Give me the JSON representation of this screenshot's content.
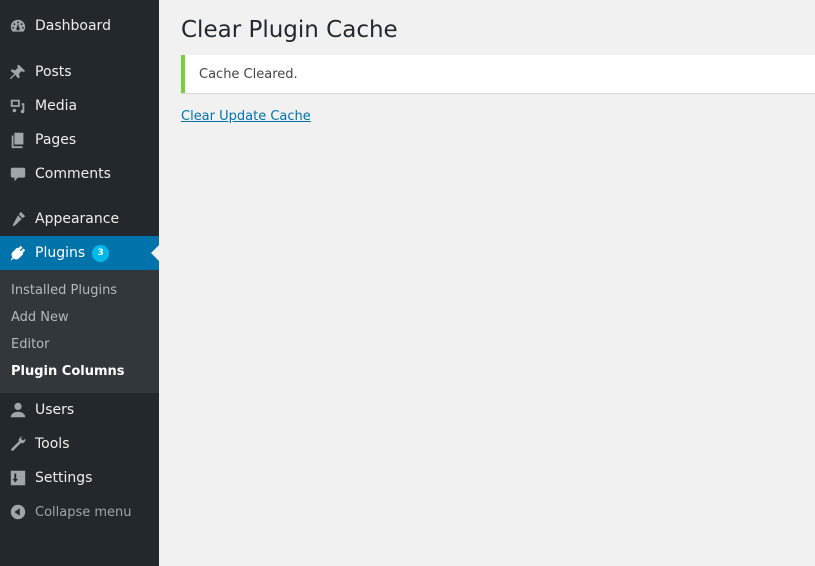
{
  "sidebar": {
    "items": [
      {
        "label": "Dashboard",
        "icon": "dashboard-icon"
      },
      {
        "label": "Posts",
        "icon": "pin-icon"
      },
      {
        "label": "Media",
        "icon": "media-icon"
      },
      {
        "label": "Pages",
        "icon": "pages-icon"
      },
      {
        "label": "Comments",
        "icon": "comment-icon"
      },
      {
        "label": "Appearance",
        "icon": "brush-icon"
      },
      {
        "label": "Plugins",
        "icon": "plugin-icon",
        "badge": "3",
        "active": true
      },
      {
        "label": "Users",
        "icon": "user-icon"
      },
      {
        "label": "Tools",
        "icon": "wrench-icon"
      },
      {
        "label": "Settings",
        "icon": "settings-icon"
      }
    ],
    "submenu": [
      {
        "label": "Installed Plugins"
      },
      {
        "label": "Add New"
      },
      {
        "label": "Editor"
      },
      {
        "label": "Plugin Columns",
        "current": true
      }
    ],
    "collapse_label": "Collapse menu"
  },
  "main": {
    "title": "Clear Plugin Cache",
    "notice": "Cache Cleared.",
    "link": "Clear Update Cache"
  },
  "colors": {
    "sidebar_bg": "#23282d",
    "active_bg": "#0073aa",
    "badge_bg": "#00b9eb",
    "notice_border": "#7ad03a",
    "link": "#0073aa"
  }
}
